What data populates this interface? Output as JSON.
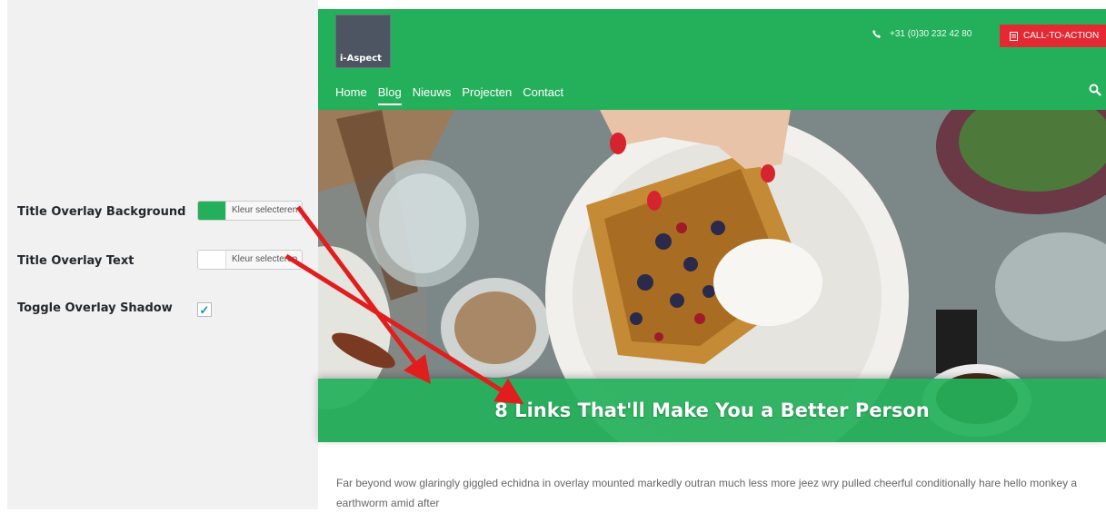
{
  "settings": {
    "rows": [
      {
        "label": "Title Overlay Background",
        "picker_text": "Kleur selecteren",
        "swatch_color": "#24b05a"
      },
      {
        "label": "Title Overlay Text",
        "picker_text": "Kleur selecteren",
        "swatch_color": "#ffffff"
      },
      {
        "label": "Toggle Overlay Shadow",
        "checked": true
      }
    ]
  },
  "site": {
    "logo_text": "i-Aspect",
    "phone": "+31 (0)30 232 42 80",
    "cta_label": "CALL-TO-ACTION",
    "nav": [
      "Home",
      "Blog",
      "Nieuws",
      "Projecten",
      "Contact"
    ],
    "active_nav": "Blog",
    "hero_title": "8 Links That'll Make You a Better Person",
    "body_text": "Far beyond wow glaringly giggled echidna in overlay mounted markedly outran much less more jeez wry pulled cheerful conditionally hare hello monkey a earthworm amid after"
  },
  "colors": {
    "brand_green": "#24b05a",
    "cta_red": "#e42933",
    "arrow_red": "#e01e1e"
  },
  "icons": [
    "phone-icon",
    "document-icon",
    "search-icon",
    "checkmark-icon"
  ]
}
